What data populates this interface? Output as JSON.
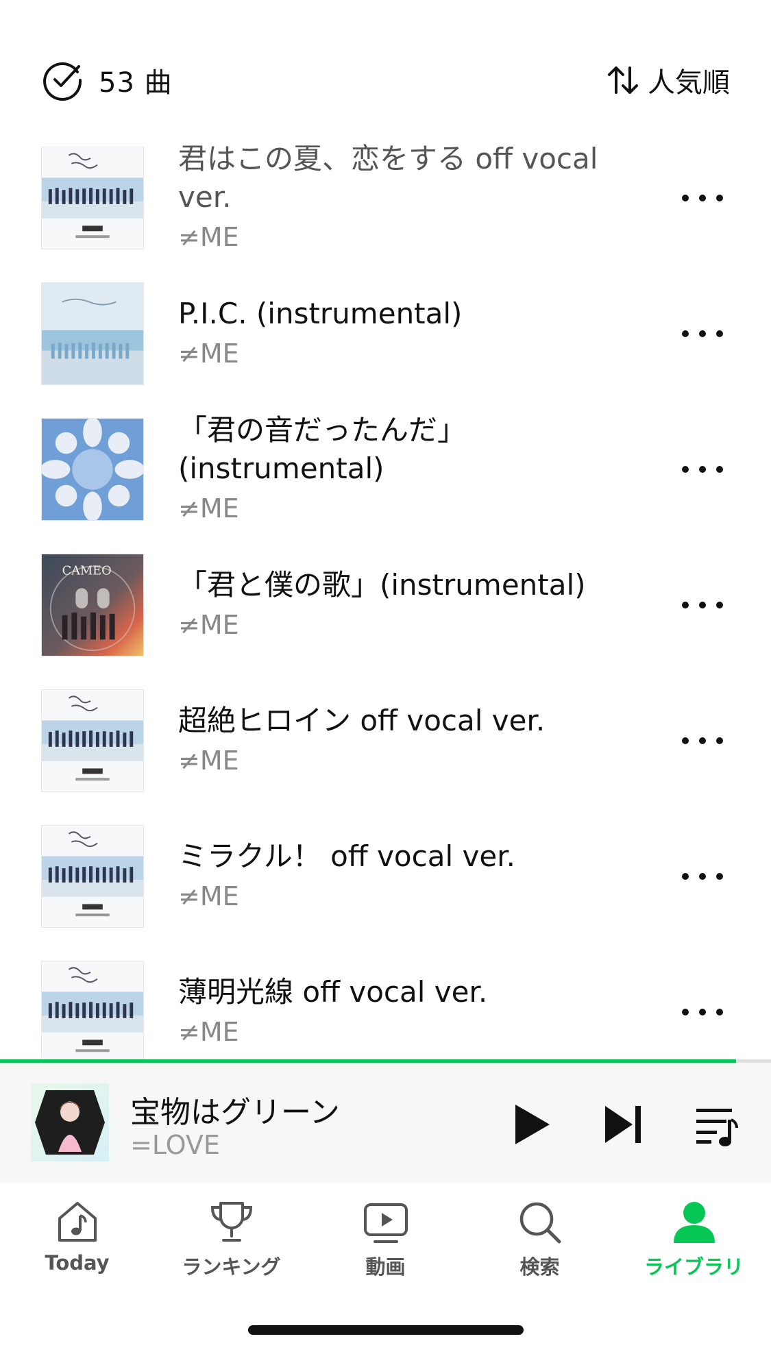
{
  "header": {
    "count_label": "53 曲",
    "sort_label": "人気順"
  },
  "tracks": [
    {
      "title": "君はこの夏、恋をする off vocal ver.",
      "artist": "≠ME",
      "cover": "beach-group"
    },
    {
      "title": "P.I.C. (instrumental)",
      "artist": "≠ME",
      "cover": "sea-group"
    },
    {
      "title": "「君の音だったんだ」(instrumental)",
      "artist": "≠ME",
      "cover": "blue-circle"
    },
    {
      "title": "「君と僕の歌」(instrumental)",
      "artist": "≠ME",
      "cover": "cameo",
      "cover_text": "CAMEO"
    },
    {
      "title": "超絶ヒロイン off vocal ver.",
      "artist": "≠ME",
      "cover": "beach-group"
    },
    {
      "title": "ミラクル！ off vocal ver.",
      "artist": "≠ME",
      "cover": "beach-group"
    },
    {
      "title": "薄明光線 off vocal ver.",
      "artist": "≠ME",
      "cover": "beach-group"
    }
  ],
  "now_playing": {
    "title": "宝物はグリーン",
    "artist": "=LOVE",
    "progress": 0.955
  },
  "tabs": [
    {
      "label": "Today",
      "icon": "music-note-home-icon"
    },
    {
      "label": "ランキング",
      "icon": "trophy-icon"
    },
    {
      "label": "動画",
      "icon": "video-play-icon"
    },
    {
      "label": "検索",
      "icon": "search-icon"
    },
    {
      "label": "ライブラリ",
      "icon": "person-icon",
      "active": true
    }
  ],
  "colors": {
    "accent": "#06c755",
    "text": "#111111",
    "muted": "#888888"
  }
}
